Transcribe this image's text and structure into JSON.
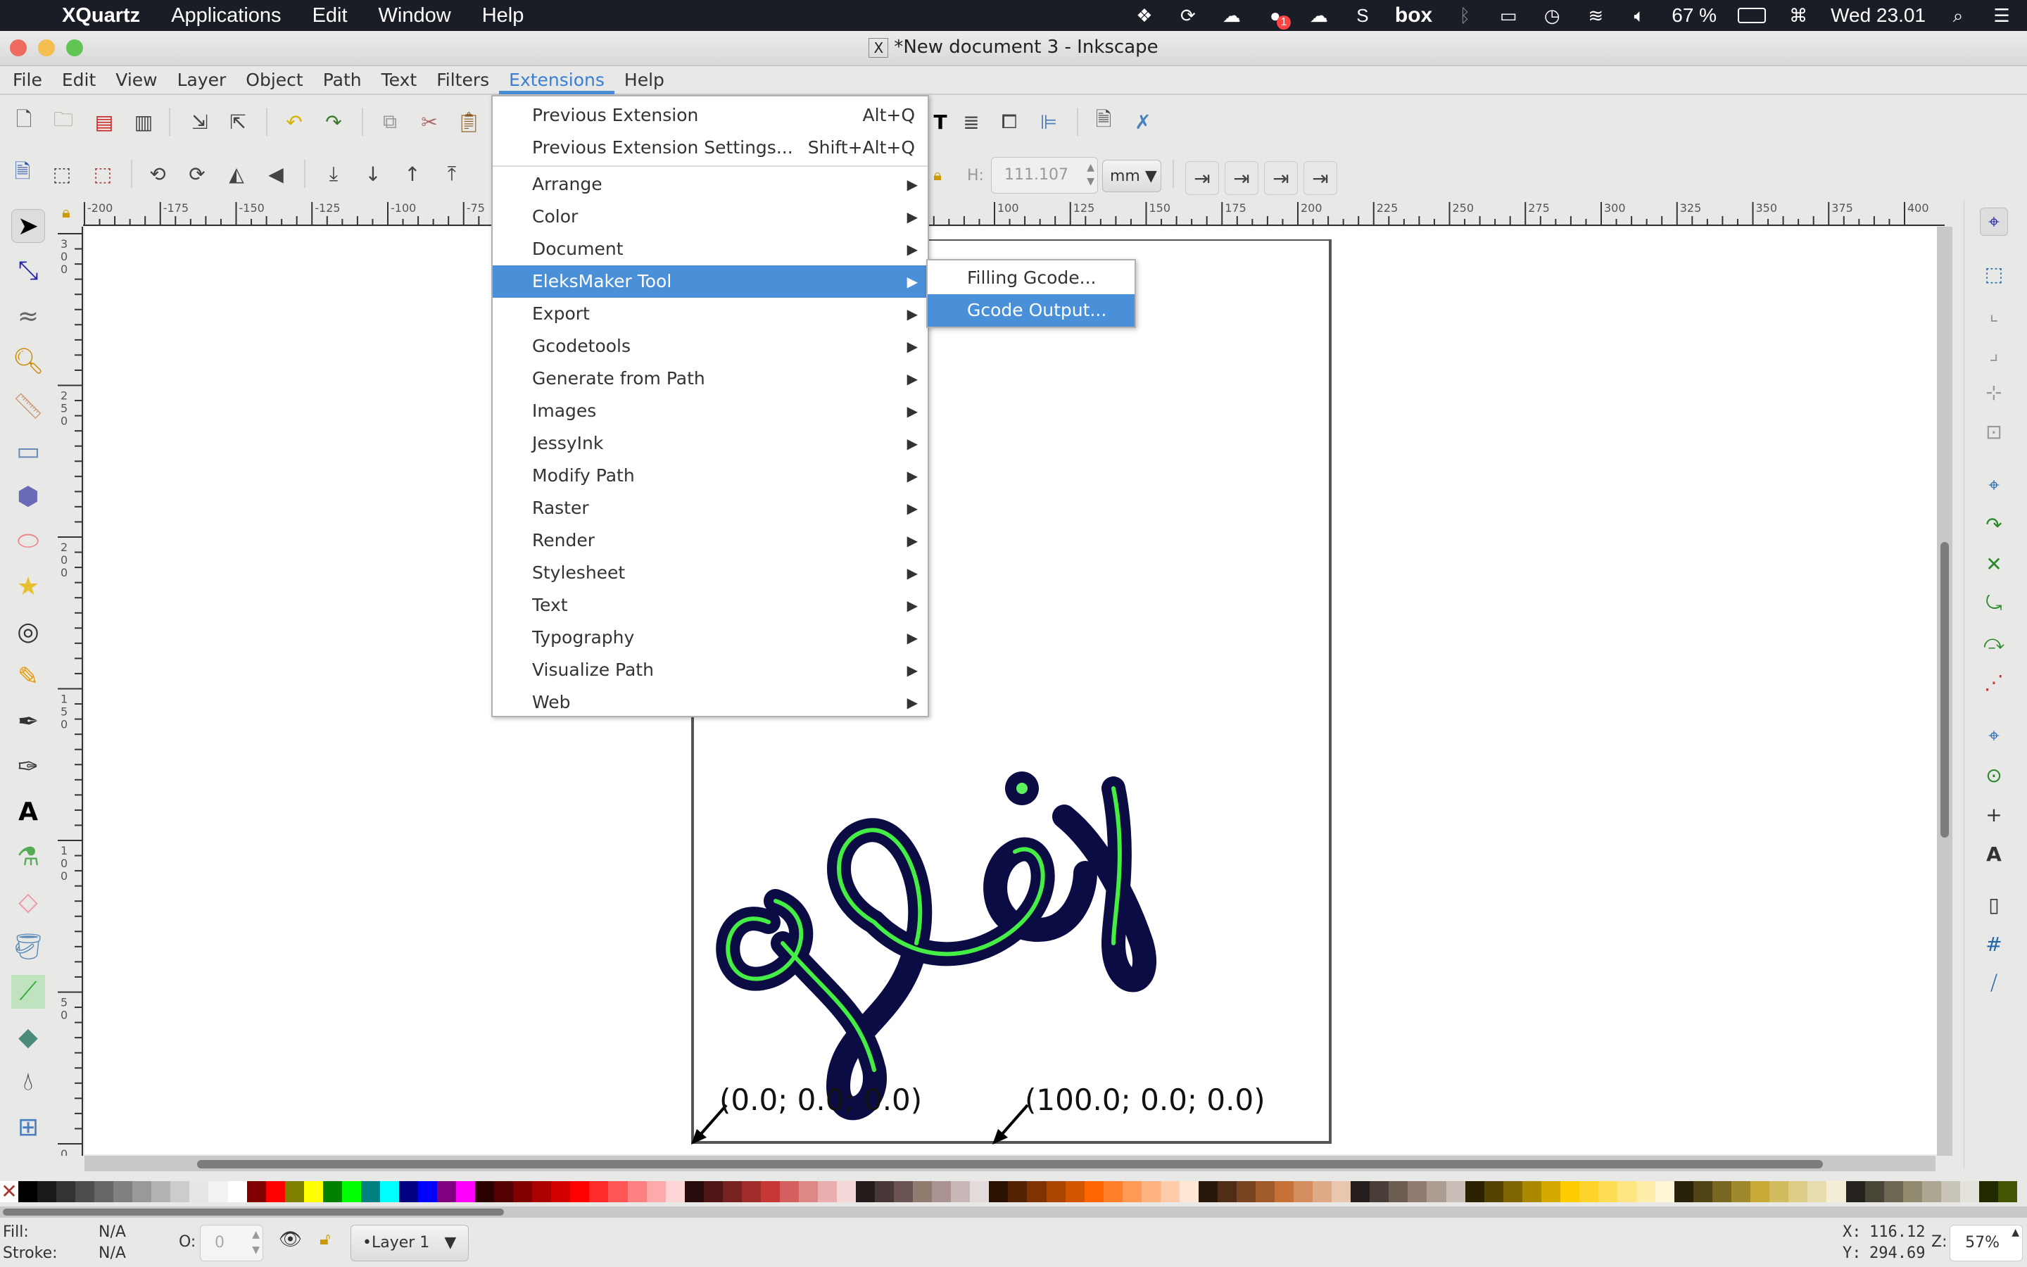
{
  "mac_menubar": {
    "apple": "",
    "app_name": "XQuartz",
    "items": [
      "Applications",
      "Edit",
      "Window",
      "Help"
    ],
    "status": {
      "battery": "67 %",
      "clock": "Wed 23.01",
      "notification_badge": "1",
      "box_label": "box"
    }
  },
  "window": {
    "title": "*New document 3 - Inkscape",
    "x_icon": "X"
  },
  "app_menu": [
    "File",
    "Edit",
    "View",
    "Layer",
    "Object",
    "Path",
    "Text",
    "Filters",
    "Extensions",
    "Help"
  ],
  "active_menu": "Extensions",
  "extensions_menu": {
    "items": [
      {
        "label": "Previous Extension",
        "shortcut": "Alt+Q"
      },
      {
        "label": "Previous Extension Settings...",
        "shortcut": "Shift+Alt+Q"
      },
      {
        "label": "Arrange",
        "submenu": true
      },
      {
        "label": "Color",
        "submenu": true
      },
      {
        "label": "Document",
        "submenu": true
      },
      {
        "label": "EleksMaker Tool",
        "submenu": true,
        "highlighted": true
      },
      {
        "label": "Export",
        "submenu": true
      },
      {
        "label": "Gcodetools",
        "submenu": true
      },
      {
        "label": "Generate from Path",
        "submenu": true
      },
      {
        "label": "Images",
        "submenu": true
      },
      {
        "label": "JessyInk",
        "submenu": true
      },
      {
        "label": "Modify Path",
        "submenu": true
      },
      {
        "label": "Raster",
        "submenu": true
      },
      {
        "label": "Render",
        "submenu": true
      },
      {
        "label": "Stylesheet",
        "submenu": true
      },
      {
        "label": "Text",
        "submenu": true
      },
      {
        "label": "Typography",
        "submenu": true
      },
      {
        "label": "Visualize Path",
        "submenu": true
      },
      {
        "label": "Web",
        "submenu": true
      }
    ],
    "arrow": "▶"
  },
  "eleksmaker_submenu": {
    "items": [
      {
        "label": "Filling Gcode..."
      },
      {
        "label": "Gcode Output...",
        "highlighted": true
      }
    ]
  },
  "tool_controls": {
    "h_label": "H:",
    "h_value": "111.107",
    "unit": "mm"
  },
  "rulers": {
    "horizontal_ticks": [
      "-200",
      "-175",
      "-150",
      "-125",
      "-100",
      "-75",
      "100",
      "125",
      "150",
      "175",
      "200",
      "225",
      "250",
      "275",
      "300",
      "325",
      "350",
      "375",
      "400"
    ],
    "vertical_ticks": [
      "300",
      "250",
      "200",
      "150",
      "100",
      "50",
      "0"
    ]
  },
  "canvas": {
    "coord_label_1": "(0.0; 0.0; 0.0)",
    "coord_label_2": "(100.0; 0.0; 0.0)"
  },
  "palette": [
    "#000000",
    "#1a1a1a",
    "#333333",
    "#4d4d4d",
    "#666666",
    "#808080",
    "#999999",
    "#b3b3b3",
    "#cccccc",
    "#e6e6e6",
    "#f2f2f2",
    "#ffffff",
    "#800000",
    "#ff0000",
    "#808000",
    "#ffff00",
    "#008000",
    "#00ff00",
    "#008080",
    "#00ffff",
    "#000080",
    "#0000ff",
    "#800080",
    "#ff00ff",
    "#2b0000",
    "#550000",
    "#800000",
    "#aa0000",
    "#d40000",
    "#ff0000",
    "#ff2a2a",
    "#ff5555",
    "#ff8080",
    "#ffaaaa",
    "#ffd5d5",
    "#280b0b",
    "#501616",
    "#782121",
    "#a02c2c",
    "#c83737",
    "#d35f5f",
    "#de8787",
    "#e9afaf",
    "#f4d7d7",
    "#241c1c",
    "#483737",
    "#6c5353",
    "#917c6f",
    "#ac9393",
    "#c8b7b7",
    "#e3dbdb",
    "#2b1100",
    "#552200",
    "#803300",
    "#aa4400",
    "#d45500",
    "#ff6600",
    "#ff7f2a",
    "#ff9955",
    "#ffb380",
    "#ffccaa",
    "#ffe6d5",
    "#28170b",
    "#502d16",
    "#784421",
    "#a05a2c",
    "#c87137",
    "#d38d5f",
    "#deaa87",
    "#e9c6af",
    "#241f1c",
    "#483e37",
    "#6c5d53",
    "#917c6f",
    "#ac9d93",
    "#c8beb7",
    "#2b2200",
    "#554400",
    "#806600",
    "#aa8800",
    "#d4aa00",
    "#ffcc00",
    "#ffd42a",
    "#ffdd55",
    "#ffe680",
    "#ffeeaa",
    "#fff6d5",
    "#28220b",
    "#504416",
    "#786721",
    "#a0892c",
    "#c8ab37",
    "#d3bc5f",
    "#decd87",
    "#e9ddaf",
    "#f4eed7",
    "#24221c",
    "#484537",
    "#6c6753",
    "#918a6f",
    "#aca793",
    "#c8c4b7",
    "#e3e2db",
    "#222b00",
    "#445500"
  ],
  "status_bar": {
    "fill_label": "Fill:",
    "fill_value": "N/A",
    "stroke_label": "Stroke:",
    "stroke_value": "N/A",
    "opacity_label": "O:",
    "opacity_value": "0",
    "layer": "•Layer 1",
    "x_label": "X:",
    "x_value": "116.12",
    "y_label": "Y:",
    "y_value": "294.69",
    "zoom_label": "Z:",
    "zoom_value": "57%"
  }
}
